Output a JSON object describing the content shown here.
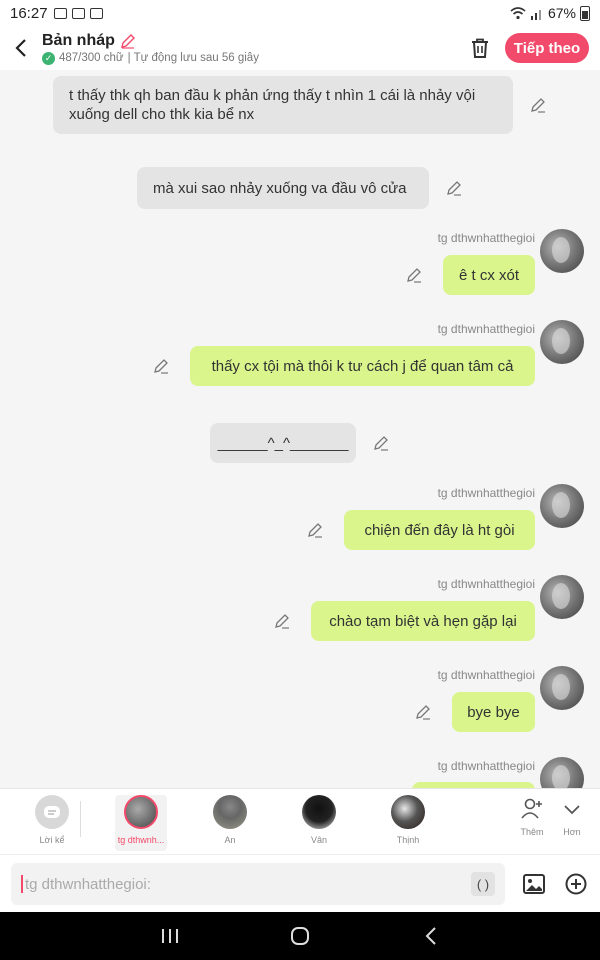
{
  "status_bar": {
    "time": "16:27",
    "battery": "67%"
  },
  "header": {
    "title": "Bản nháp",
    "word_count": "487/300 chữ",
    "autosave": "| Tự động lưu sau 56 giây",
    "next_label": "Tiếp theo",
    "accent_color": "#f24a6a"
  },
  "messages": [
    {
      "type": "narration",
      "text": "t thấy thk qh ban đầu k phản ứng thấy t nhìn 1 cái là nhảy vội xuống dell cho thk kia bể nx"
    },
    {
      "type": "narration",
      "text": "mà xui sao nhảy xuống va đầu vô cửa"
    },
    {
      "type": "character",
      "speaker": "tg dthwnhatthegioi",
      "text": "ê t cx xót"
    },
    {
      "type": "character",
      "speaker": "tg dthwnhatthegioi",
      "text": "thấy cx tội mà thôi k tư cách j để quan tâm cả"
    },
    {
      "type": "narration",
      "text": "______^_^_______"
    },
    {
      "type": "character",
      "speaker": "tg dthwnhatthegioi",
      "text": "chiện đến đây là ht gòi"
    },
    {
      "type": "character",
      "speaker": "tg dthwnhatthegioi",
      "text": "chào tạm biệt và hẹn gặp lại"
    },
    {
      "type": "character",
      "speaker": "tg dthwnhatthegioi",
      "text": "bye bye"
    },
    {
      "type": "character",
      "speaker": "tg dthwnhatthegioi",
      "text": ""
    }
  ],
  "characters": {
    "narration_label": "Lời kể",
    "list": [
      {
        "name": "tg dthwnh...",
        "selected": true
      },
      {
        "name": "An"
      },
      {
        "name": "Vân"
      },
      {
        "name": "Thịnh"
      }
    ],
    "add_label": "Thêm",
    "more_label": "Hơn"
  },
  "input": {
    "placeholder": "tg dthwnhatthegioi:",
    "paren_label": "( )"
  },
  "colors": {
    "green_bubble": "#d9f58c",
    "gray_bubble": "#e4e4e4"
  }
}
